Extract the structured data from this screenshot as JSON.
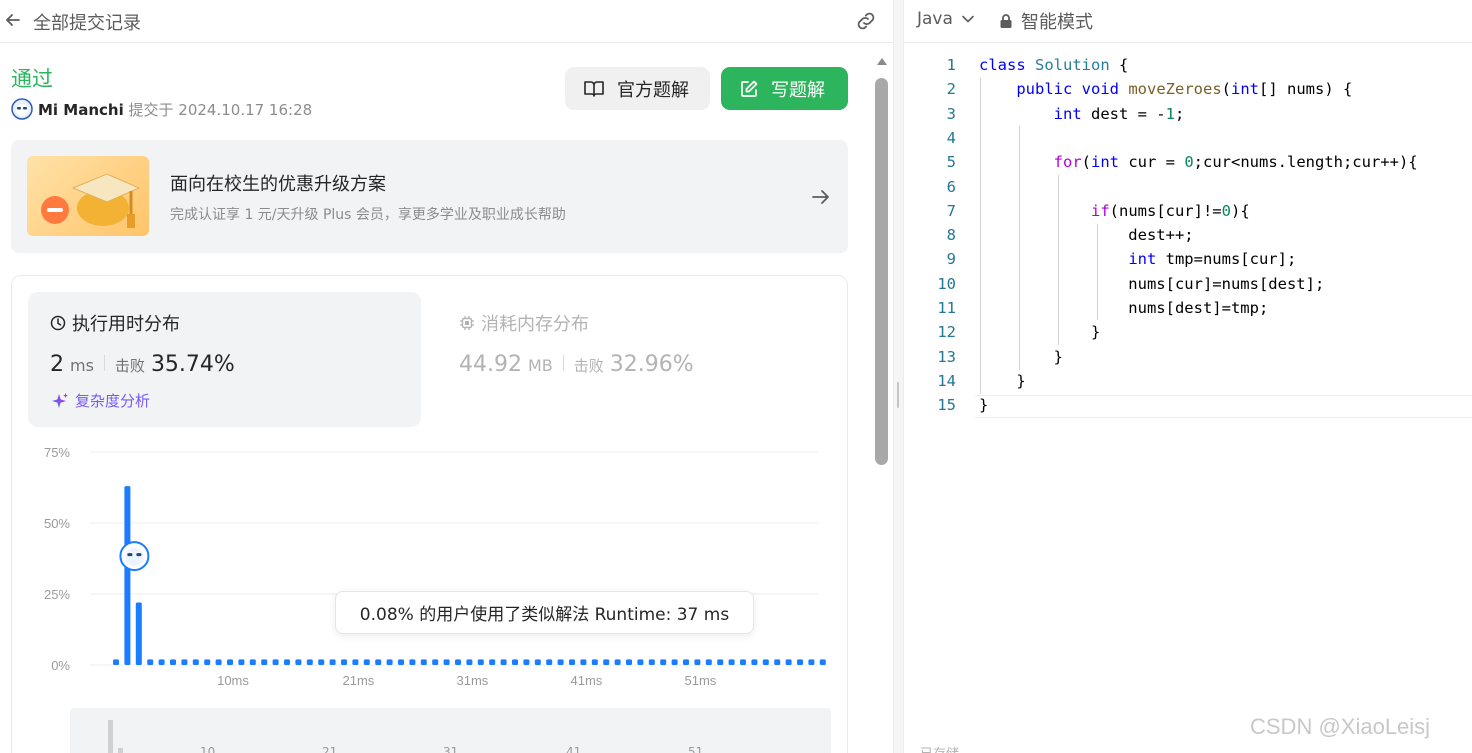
{
  "left_header": {
    "title": "全部提交记录"
  },
  "submission": {
    "status": "通过",
    "user": "Mi Manchi",
    "submitted_text": "提交于 2024.10.17 16:28"
  },
  "actions": {
    "official_label": "官方题解",
    "write_label": "写题解"
  },
  "promo": {
    "title": "面向在校生的优惠升级方案",
    "subtitle": "完成认证享 1 元/天升级 Plus 会员，享更多学业及职业成长帮助"
  },
  "runtime": {
    "heading": "执行用时分布",
    "value": "2",
    "unit": "ms",
    "beat_label": "击败",
    "beat_pct": "35.74%",
    "complexity_label": "复杂度分析"
  },
  "memory": {
    "heading": "消耗内存分布",
    "value": "44.92",
    "unit": "MB",
    "beat_label": "击败",
    "beat_pct": "32.96%"
  },
  "tooltip": {
    "text": "0.08% 的用户使用了类似解法 Runtime: 37 ms"
  },
  "colors": {
    "accent_green": "#2db55d",
    "bar_blue": "#1a7cff",
    "purple": "#7a5af5"
  },
  "chart_data": {
    "type": "bar",
    "title": "",
    "xlabel": "",
    "ylabel": "",
    "ylim": [
      0,
      75
    ],
    "y_ticks": [
      "75%",
      "50%",
      "25%",
      "0%"
    ],
    "y_tick_values": [
      75,
      50,
      25,
      0
    ],
    "x_ticks": [
      "10ms",
      "21ms",
      "31ms",
      "41ms",
      "51ms"
    ],
    "x_tick_bins": [
      10,
      21,
      31,
      41,
      51
    ],
    "bin_start": 0,
    "values": [
      2,
      63,
      22,
      2,
      2,
      2,
      2,
      2,
      2,
      2,
      2,
      2,
      2,
      2,
      2,
      2,
      2,
      2,
      2,
      2,
      2,
      2,
      2,
      2,
      2,
      2,
      2,
      2,
      2,
      2,
      2,
      2,
      2,
      2,
      2,
      2,
      2,
      2,
      2,
      2,
      2,
      2,
      2,
      2,
      2,
      2,
      2,
      2,
      2,
      2,
      2,
      2,
      2,
      2,
      2,
      2,
      2,
      2,
      2,
      2,
      2,
      2,
      2,
      2
    ],
    "user_marker_bin": 1,
    "grid": true
  },
  "minimap": {
    "labels": [
      "10",
      "21",
      "31",
      "41",
      "51"
    ]
  },
  "editor": {
    "language": "Java",
    "mode": "智能模式",
    "code_lines": [
      "class Solution {",
      "    public void moveZeroes(int[] nums) {",
      "        int dest = -1;",
      "",
      "        for(int cur = 0;cur<nums.length;cur++){",
      "",
      "            if(nums[cur]!=0){",
      "                dest++;",
      "                int tmp=nums[cur];",
      "                nums[cur]=nums[dest];",
      "                nums[dest]=tmp;",
      "            }",
      "        }",
      "    }",
      "}"
    ],
    "saved_label": "已存储"
  },
  "watermark": "CSDN @XiaoLeisj"
}
